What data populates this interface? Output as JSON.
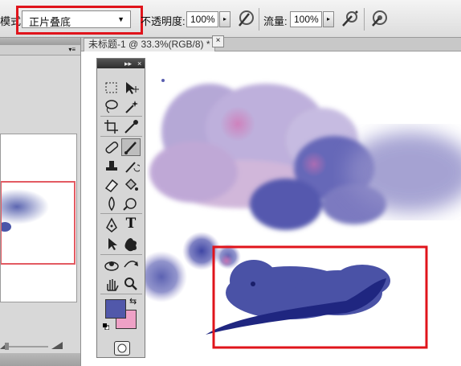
{
  "optbar": {
    "mode_label_partial": "模式",
    "mode_value": "正片叠底",
    "opacity_label": "不透明度:",
    "opacity_value": "100%",
    "flow_label": "流量:",
    "flow_value": "100%"
  },
  "document": {
    "tab_title": "未标题-1 @ 33.3%(RGB/8) *",
    "close_glyph": "×"
  },
  "colors": {
    "foreground": "#5158aa",
    "background": "#eea1c6",
    "highlight": "#e0141b"
  },
  "tools": [
    "marquee-tool",
    "move-tool",
    "lasso-tool",
    "magic-wand-tool",
    "crop-tool",
    "eyedropper-tool",
    "healing-brush-tool",
    "brush-tool",
    "clone-stamp-tool",
    "history-brush-tool",
    "eraser-tool",
    "paint-bucket-tool",
    "blur-tool",
    "dodge-tool",
    "pen-tool",
    "type-tool",
    "path-selection-tool",
    "custom-shape-tool",
    "3d-rotate-tool",
    "3d-orbit-tool",
    "hand-tool",
    "zoom-tool"
  ],
  "tools_panel": {
    "type_tool_glyph": "T",
    "collapse_glyph": "▸▸",
    "close_glyph": "×"
  }
}
